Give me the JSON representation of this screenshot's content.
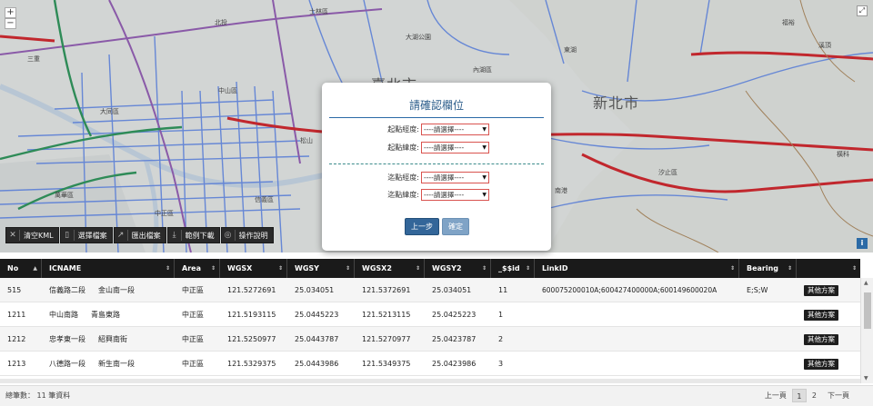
{
  "map": {
    "labels": {
      "city_taipei": "臺北市",
      "city_newtaipei": "新北市",
      "xizhi": "汐止區",
      "dahu": "大湖公園",
      "neihu": "內湖區",
      "donghu": "東湖",
      "songshan": "松山",
      "nangang": "南港",
      "datong": "大同區",
      "zhongshan": "中山區",
      "wanhua": "萬華區",
      "sanchong": "三重",
      "shilin": "士林區",
      "xinyi": "信義區",
      "zhongzheng": "中正區",
      "beitou": "北投",
      "fuyu": "福裕",
      "xiding": "溪頂",
      "hengke": "橫科"
    },
    "zoom_in": "+",
    "zoom_out": "−",
    "expand": "⤢",
    "info": "i"
  },
  "toolbar": [
    {
      "label": "清空KML",
      "icon": "close-icon"
    },
    {
      "label": "選擇檔案",
      "icon": "file-icon"
    },
    {
      "label": "匯出檔案",
      "icon": "export-icon"
    },
    {
      "label": "範例下載",
      "icon": "download-icon"
    },
    {
      "label": "操作說明",
      "icon": "help-icon"
    }
  ],
  "modal": {
    "title": "請確認欄位",
    "fields": [
      {
        "label": "起點經度:",
        "value": "----請選擇----"
      },
      {
        "label": "起點緯度:",
        "value": "----請選擇----"
      },
      {
        "label": "迄點經度:",
        "value": "----請選擇----"
      },
      {
        "label": "迄點緯度:",
        "value": "----請選擇----"
      }
    ],
    "prev_button": "上一步",
    "ok_button": "確定"
  },
  "table": {
    "columns": [
      "No",
      "ICNAME",
      "Area",
      "WGSX",
      "WGSY",
      "WGSX2",
      "WGSY2",
      "_$$id",
      "LinkID",
      "Bearing",
      ""
    ],
    "rows": [
      {
        "no": "515",
        "icname1": "信義路二段",
        "icname2": "金山南一段",
        "area": "中正區",
        "wgsx": "121.5272691",
        "wgsy": "25.034051",
        "wgsx2": "121.5372691",
        "wgsy2": "25.034051",
        "id": "11",
        "linkid": "600075200010A;600427400000A;600149600020A",
        "bearing": "E;S;W",
        "action": "其他方案"
      },
      {
        "no": "1211",
        "icname1": "中山南路",
        "icname2": "青島東路",
        "area": "中正區",
        "wgsx": "121.5193115",
        "wgsy": "25.0445223",
        "wgsx2": "121.5213115",
        "wgsy2": "25.0425223",
        "id": "1",
        "linkid": "",
        "bearing": "",
        "action": "其他方案"
      },
      {
        "no": "1212",
        "icname1": "忠孝東一段",
        "icname2": "紹興南街",
        "area": "中正區",
        "wgsx": "121.5250977",
        "wgsy": "25.0443787",
        "wgsx2": "121.5270977",
        "wgsy2": "25.0423787",
        "id": "2",
        "linkid": "",
        "bearing": "",
        "action": "其他方案"
      },
      {
        "no": "1213",
        "icname1": "八德路一段",
        "icname2": "新生南一段",
        "area": "中正區",
        "wgsx": "121.5329375",
        "wgsy": "25.0443986",
        "wgsx2": "121.5349375",
        "wgsy2": "25.0423986",
        "id": "3",
        "linkid": "",
        "bearing": "",
        "action": "其他方案"
      }
    ]
  },
  "footer": {
    "count": "總筆數： 11 筆資料",
    "prev": "上一頁",
    "pages": [
      "1",
      "2"
    ],
    "next": "下一頁"
  }
}
